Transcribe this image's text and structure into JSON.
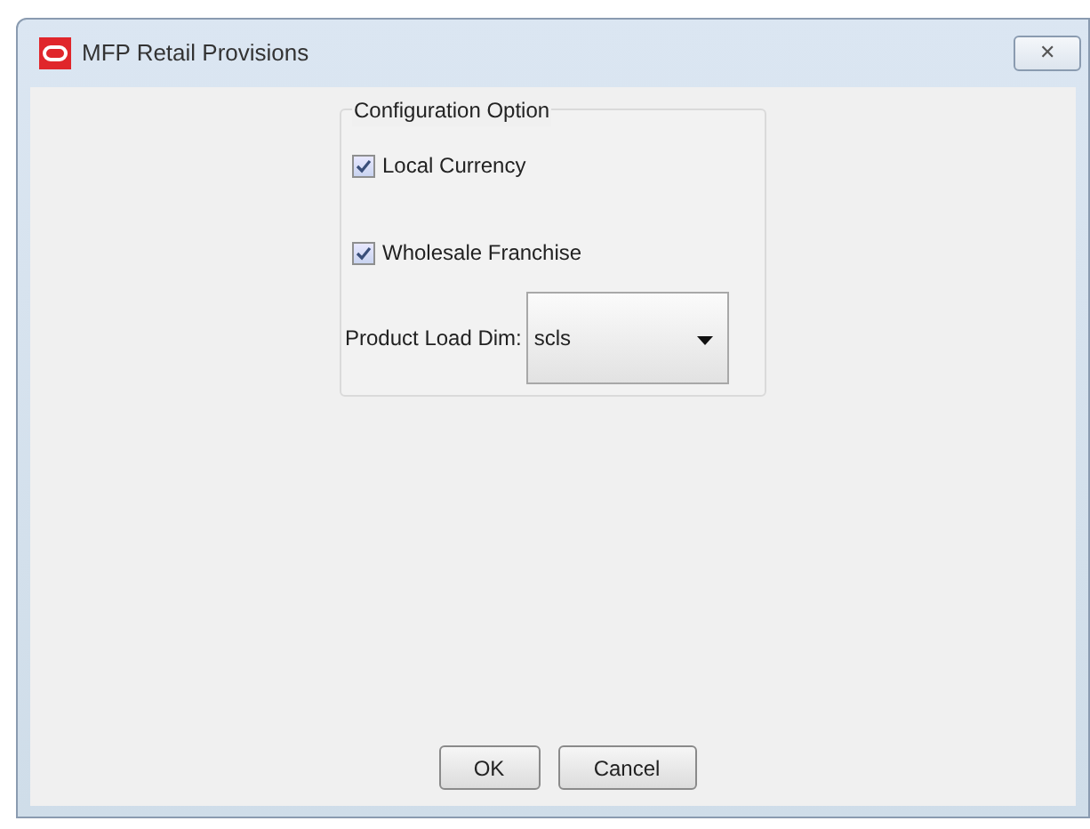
{
  "window": {
    "title": "MFP Retail Provisions",
    "close": "✕"
  },
  "group": {
    "title": "Configuration Option",
    "options": [
      {
        "label": "Local Currency",
        "checked": true
      },
      {
        "label": "Wholesale Franchise",
        "checked": true
      }
    ],
    "dropdown": {
      "label": "Product Load Dim:",
      "value": "scls"
    }
  },
  "buttons": [
    "OK",
    "Cancel"
  ]
}
